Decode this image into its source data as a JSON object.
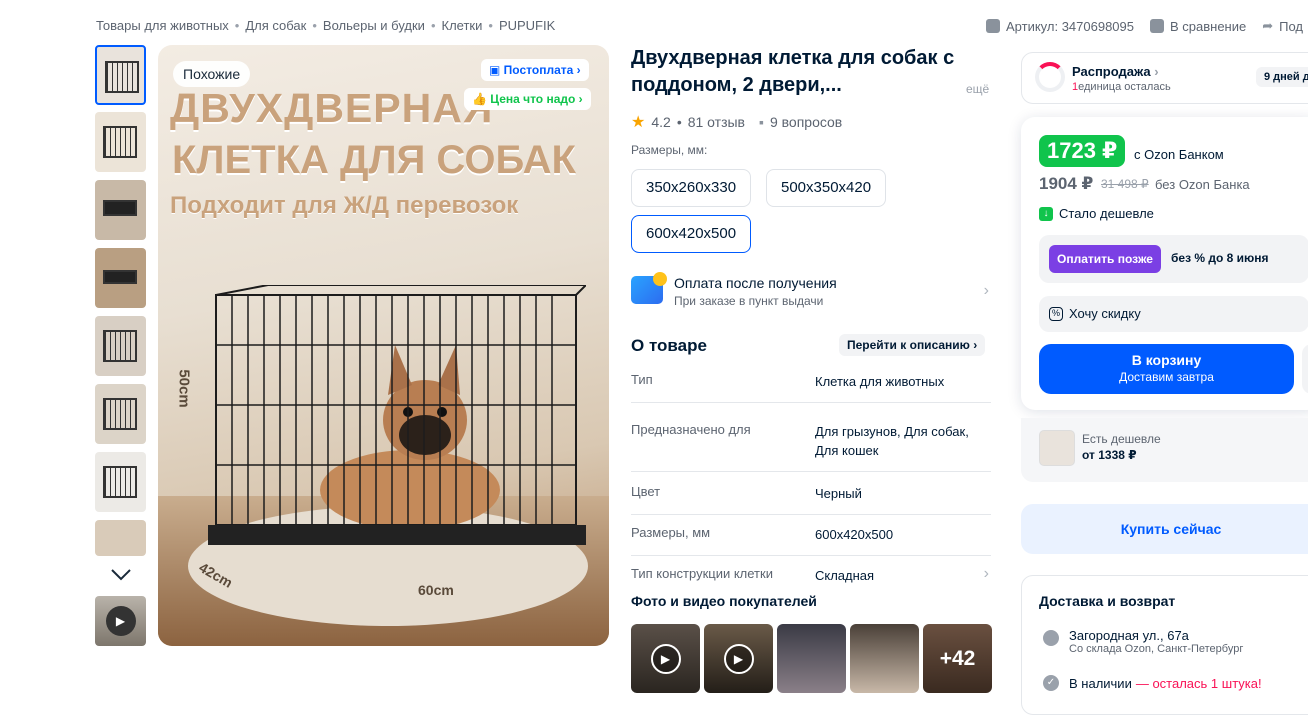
{
  "breadcrumbs": [
    "Товары для животных",
    "Для собак",
    "Вольеры и будки",
    "Клетки",
    "PUPUFIK"
  ],
  "breadcrumb_separator": "•",
  "header_actions": {
    "article": "Артикул: 3470698095",
    "compare": "В сравнение",
    "share": "Под"
  },
  "gallery": {
    "similar_badge": "Похожие",
    "postpay_badge": "Постоплата",
    "good_price_badge": "Цена что надо",
    "headline_line1": "ДВУХДВЕРНАЯ",
    "headline_line2": "КЛЕТКА ДЛЯ СОБАК",
    "headline_line3": "Подходит для Ж/Д перевозок",
    "dim_height": "50cm",
    "dim_depth": "42cm",
    "dim_width": "60cm",
    "thumbnail_count": 8
  },
  "product": {
    "title": "Двухдверная клетка для собак с поддоном, 2 двери,...",
    "more": "ещё",
    "rating": "4.2",
    "reviews": "81 отзыв",
    "questions": "9 вопросов",
    "sizes_label": "Размеры, мм:",
    "sizes": [
      "350x260x330",
      "500x350x420",
      "600x420x500"
    ],
    "selected_size": "600x420x500",
    "payment_title": "Оплата после получения",
    "payment_subtitle": "При заказе в пункт выдачи"
  },
  "about": {
    "title": "О товаре",
    "goto": "Перейти к описанию",
    "specs": [
      {
        "key": "Тип",
        "value": "Клетка для животных"
      },
      {
        "key": "Предназначено для",
        "value": "Для грызунов, Для собак, Для кошек"
      },
      {
        "key": "Цвет",
        "value": "Черный"
      },
      {
        "key": "Размеры, мм",
        "value": "600x420x500"
      },
      {
        "key": "Тип конструкции клетки",
        "value": "Складная"
      }
    ]
  },
  "customer_media": {
    "title": "Фото и видео покупателей",
    "more_count": "+42"
  },
  "sale": {
    "title": "Распродажа",
    "left_count": "1",
    "left_text": "единица осталась",
    "days": "9 дней д"
  },
  "price": {
    "bank_price": "1723 ₽",
    "bank_label": "с Ozon Банком",
    "regular_price": "1904 ₽",
    "old_price": "31 498 ₽",
    "no_bank_label": "без Ozon Банка",
    "cheaper": "Стало дешевле",
    "pay_later_button": "Оплатить позже",
    "pay_later_text": "без % до 8 июня",
    "want_discount": "Хочу скидку",
    "cart_button": "В корзину",
    "cart_sub": "Доставим завтра",
    "cheaper_elsewhere": "Есть дешевле",
    "cheaper_from": "от 1338 ₽",
    "buy_now": "Купить сейчас"
  },
  "delivery": {
    "title": "Доставка и возврат",
    "address": "Загородная ул., 67а",
    "warehouse": "Со склада Ozon, Санкт-Петербург",
    "stock": "В наличии",
    "stock_warning": "— осталась 1 штука!"
  },
  "colors": {
    "accent": "#005bff",
    "green": "#10c44c",
    "purple": "#7b3fe4",
    "pink": "#f91155"
  }
}
